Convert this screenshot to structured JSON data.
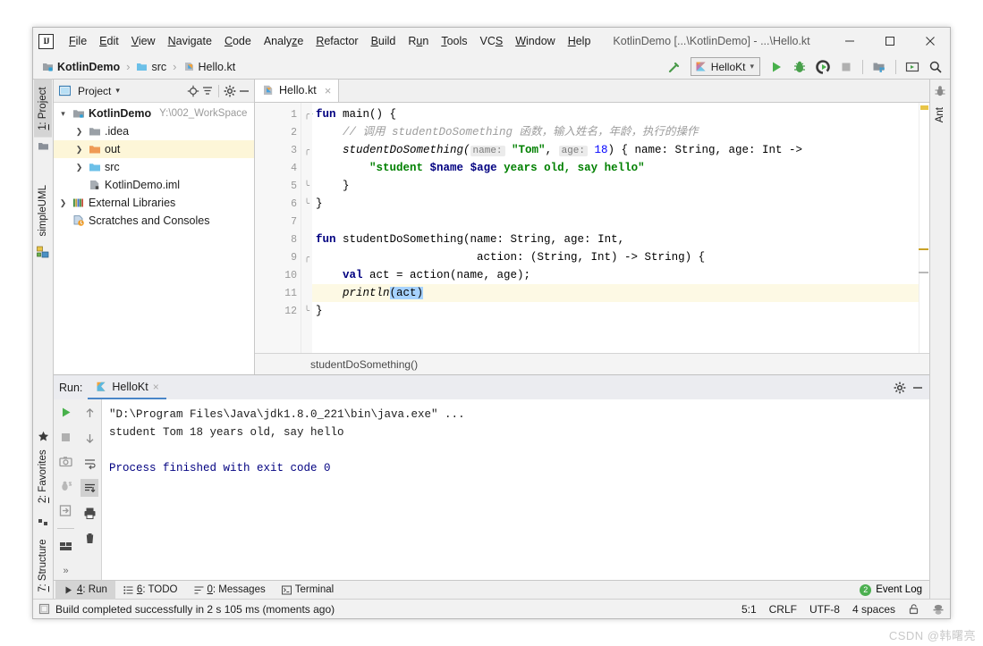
{
  "window": {
    "title": "KotlinDemo [...\\KotlinDemo] - ...\\Hello.kt",
    "logo": "IJ",
    "minimize": "minimize-icon",
    "maximize": "maximize-icon",
    "close": "close-icon"
  },
  "menubar": {
    "items": [
      {
        "label": "File",
        "mnemonic": "F"
      },
      {
        "label": "Edit",
        "mnemonic": "E"
      },
      {
        "label": "View",
        "mnemonic": "V"
      },
      {
        "label": "Navigate",
        "mnemonic": "N"
      },
      {
        "label": "Code",
        "mnemonic": "C"
      },
      {
        "label": "Analyze",
        "mnemonic": "z"
      },
      {
        "label": "Refactor",
        "mnemonic": "R"
      },
      {
        "label": "Build",
        "mnemonic": "B"
      },
      {
        "label": "Run",
        "mnemonic": "u"
      },
      {
        "label": "Tools",
        "mnemonic": "T"
      },
      {
        "label": "VCS",
        "mnemonic": "S"
      },
      {
        "label": "Window",
        "mnemonic": "W"
      },
      {
        "label": "Help",
        "mnemonic": "H"
      }
    ]
  },
  "navbar": {
    "breadcrumb": [
      {
        "label": "KotlinDemo",
        "icon": "module-icon",
        "bold": true
      },
      {
        "label": "src",
        "icon": "folder-icon",
        "bold": false
      },
      {
        "label": "Hello.kt",
        "icon": "kotlin-file-icon",
        "bold": false
      }
    ],
    "separator": "›",
    "run_config": "HelloKt",
    "toolbar_icons": [
      "build-hammer-icon",
      "run-icon",
      "debug-icon",
      "run-with-coverage-icon",
      "stop-icon",
      "project-structure-icon",
      "updates-icon",
      "search-everywhere-icon"
    ]
  },
  "left_stripe": {
    "tabs": [
      {
        "label": "1: Project",
        "mnemonic": "1",
        "active": true,
        "icon": "project-icon"
      },
      {
        "label": "simpleUML",
        "mnemonic": "",
        "active": false,
        "icon": "uml-icon"
      }
    ],
    "bottom_tabs": [
      {
        "label": "7: Structure",
        "mnemonic": "7",
        "icon": "structure-icon"
      },
      {
        "label": "2: Favorites",
        "mnemonic": "2",
        "icon": "star-icon"
      }
    ]
  },
  "right_stripe": {
    "tabs": [
      {
        "label": "Ant",
        "icon": "ant-icon"
      }
    ]
  },
  "project_panel": {
    "title": "Project",
    "dropdown": "chevron-down-icon",
    "actions": [
      "locate-icon",
      "collapse-all-icon",
      "settings-gear-icon",
      "hide-icon"
    ],
    "tree": [
      {
        "label": "KotlinDemo",
        "path": "Y:\\002_WorkSpace",
        "indent": 0,
        "arrow": "⌄",
        "icon": "module-icon",
        "bold": true,
        "selected": false
      },
      {
        "label": ".idea",
        "path": "",
        "indent": 1,
        "arrow": "›",
        "icon": "folder-gray-icon",
        "bold": false,
        "selected": false
      },
      {
        "label": "out",
        "path": "",
        "indent": 1,
        "arrow": "›",
        "icon": "folder-orange-icon",
        "bold": false,
        "selected": true
      },
      {
        "label": "src",
        "path": "",
        "indent": 1,
        "arrow": "›",
        "icon": "folder-blue-icon",
        "bold": false,
        "selected": false
      },
      {
        "label": "KotlinDemo.iml",
        "path": "",
        "indent": 2,
        "arrow": "",
        "icon": "iml-file-icon",
        "bold": false,
        "selected": false
      },
      {
        "label": "External Libraries",
        "path": "",
        "indent": 0,
        "arrow": "›",
        "icon": "libraries-icon",
        "bold": false,
        "selected": false
      },
      {
        "label": "Scratches and Consoles",
        "path": "",
        "indent": 0,
        "arrow": "",
        "icon": "scratches-icon",
        "bold": false,
        "selected": false
      }
    ]
  },
  "editor": {
    "tab": {
      "label": "Hello.kt",
      "icon": "kotlin-file-icon",
      "close": "×"
    },
    "breadcrumb": "studentDoSomething()",
    "lines": [
      {
        "n": 1,
        "gutter_run": true,
        "fold": "top",
        "hl": false
      },
      {
        "n": 2,
        "gutter_run": false,
        "fold": "",
        "hl": false
      },
      {
        "n": 3,
        "gutter_run": false,
        "fold": "top",
        "hl": false
      },
      {
        "n": 4,
        "gutter_run": false,
        "fold": "",
        "hl": false
      },
      {
        "n": 5,
        "gutter_run": false,
        "fold": "bottom",
        "hl": false
      },
      {
        "n": 6,
        "gutter_run": false,
        "fold": "bottom",
        "hl": false
      },
      {
        "n": 7,
        "gutter_run": false,
        "fold": "",
        "hl": false
      },
      {
        "n": 8,
        "gutter_run": false,
        "fold": "",
        "hl": false
      },
      {
        "n": 9,
        "gutter_run": false,
        "fold": "top",
        "hl": false
      },
      {
        "n": 10,
        "gutter_run": false,
        "fold": "",
        "hl": false
      },
      {
        "n": 11,
        "gutter_run": false,
        "fold": "",
        "hl": true
      },
      {
        "n": 12,
        "gutter_run": false,
        "fold": "bottom",
        "hl": false
      }
    ],
    "code": {
      "l1_kw": "fun",
      "l1_rest": " main() {",
      "l2": "    // 调用 studentDoSomething 函数，输入姓名，年龄，执行的操作",
      "l3_pre": "    studentDoSomething(",
      "l3_hint1": "name:",
      "l3_str": " \"Tom\"",
      "l3_mid": ", ",
      "l3_hint2": "age:",
      "l3_num": " 18",
      "l3_post": ") { name: String, age: Int ->",
      "l4": "        \"student ",
      "l4_var1": "$name",
      "l4_mid": " ",
      "l4_var2": "$age",
      "l4_end": " years old, say hello\"",
      "l5": "    }",
      "l6": "}",
      "l7": "",
      "l8_kw": "fun",
      "l8_rest": " studentDoSomething(name: String, age: Int,",
      "l9": "                        action: (String, Int) -> String) {",
      "l10_pre": "    ",
      "l10_kw": "val",
      "l10_rest": " act = action(name, age);",
      "l11_pre": "    println",
      "l11_sel": "(act)",
      "l12": "}"
    }
  },
  "run_panel": {
    "label": "Run:",
    "tab": {
      "label": "HelloKt",
      "icon": "kotlin-file-icon",
      "close": "×"
    },
    "header_actions": [
      "settings-gear-icon",
      "hide-icon"
    ],
    "tools_left": [
      "rerun-icon",
      "stop-icon",
      "screenshot-icon",
      "debug-attach-icon",
      "export-icon",
      "layout-icon",
      "expand-more-icon"
    ],
    "tools_right": [
      "scroll-up-icon",
      "scroll-down-icon",
      "soft-wrap-icon",
      "scroll-to-end-icon",
      "print-icon",
      "clear-all-icon"
    ],
    "console": [
      {
        "text": "\"D:\\Program Files\\Java\\jdk1.8.0_221\\bin\\java.exe\" ...",
        "style": "cmd"
      },
      {
        "text": "student Tom 18 years old, say hello",
        "style": "plain"
      },
      {
        "text": "",
        "style": "plain"
      },
      {
        "text": "Process finished with exit code 0",
        "style": "proc"
      }
    ]
  },
  "bottom_tabs": {
    "tabs": [
      {
        "label": "4: Run",
        "mnemonic": "4",
        "icon": "run-icon",
        "active": true
      },
      {
        "label": "6: TODO",
        "mnemonic": "6",
        "icon": "todo-icon",
        "active": false
      },
      {
        "label": "0: Messages",
        "mnemonic": "0",
        "icon": "messages-icon",
        "active": false
      },
      {
        "label": "Terminal",
        "mnemonic": "",
        "icon": "terminal-icon",
        "active": false
      }
    ],
    "event_log": {
      "label": "Event Log",
      "count": "2"
    }
  },
  "statusbar": {
    "message": "Build completed successfully in 2 s 105 ms (moments ago)",
    "message_icon": "build-status-icon",
    "caret": "5:1",
    "line_sep": "CRLF",
    "encoding": "UTF-8",
    "indent": "4 spaces",
    "lock_icon": "unlock-icon",
    "inspect_icon": "inspector-icon"
  },
  "watermark": "CSDN @韩曙亮",
  "colors": {
    "accent": "#4a86c8",
    "green": "#3c9b3c",
    "selection": "#a6d2ff",
    "highlight": "#fdf9e4",
    "tree_selection": "#fdf6d8",
    "keyword": "#000080",
    "string": "#008000",
    "number": "#0000ff",
    "comment": "#9d9d9d"
  }
}
